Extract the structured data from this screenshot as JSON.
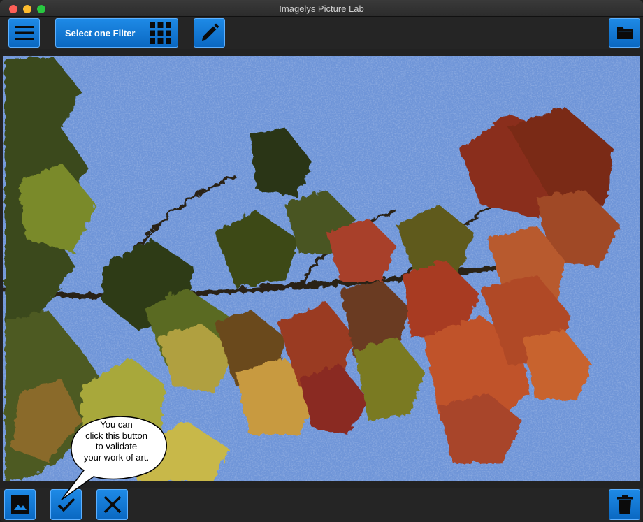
{
  "window": {
    "title": "Imagelys Picture Lab"
  },
  "toolbar": {
    "filter_label": "Select one Filter",
    "menu_icon": "hamburger-icon",
    "grid_icon": "grid-icon",
    "edit_icon": "pencil-icon",
    "folder_icon": "folder-icon"
  },
  "bottombar": {
    "image_icon": "image-icon",
    "check_icon": "checkmark-icon",
    "cancel_icon": "x-icon",
    "trash_icon": "trash-icon"
  },
  "tooltip": {
    "lines": [
      "You can",
      "click this button",
      "to validate",
      "your work of art."
    ]
  },
  "colors": {
    "accent": "#0a78d8",
    "accent_border": "#5db0ff",
    "sky": "#6f95d8",
    "toolbar": "#252525"
  }
}
